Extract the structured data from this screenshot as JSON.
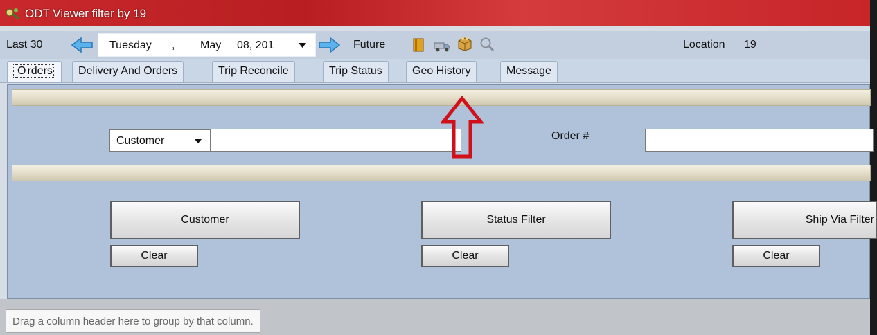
{
  "window": {
    "title": "ODT Viewer filter by 19",
    "app_icon": "filter-app-icon"
  },
  "toolbar": {
    "last_label": "Last 30",
    "date": {
      "day": "Tuesday",
      "sep": ",",
      "month": "May",
      "date": "08, 201"
    },
    "future_label": "Future",
    "location_label": "Location",
    "location_value": "19",
    "icons": [
      "back-arrow-icon",
      "forward-arrow-icon",
      "book-icon",
      "truck-icon",
      "package-icon",
      "search-icon"
    ]
  },
  "tabs": [
    {
      "pre": "",
      "u": "O",
      "post": "rders",
      "active": true
    },
    {
      "pre": "",
      "u": "D",
      "post": "elivery And Orders",
      "active": false
    },
    {
      "pre": "Trip ",
      "u": "R",
      "post": "econcile",
      "active": false
    },
    {
      "pre": "Trip ",
      "u": "S",
      "post": "tatus",
      "active": false
    },
    {
      "pre": "Geo ",
      "u": "H",
      "post": "istory",
      "active": false
    },
    {
      "pre": "Message",
      "u": "",
      "post": "",
      "active": false
    }
  ],
  "filters": {
    "search_by": "Customer",
    "search_value": "",
    "order_label": "Order #",
    "order_value": ""
  },
  "buttons": {
    "customer": "Customer",
    "status_filter": "Status Filter",
    "ship_via_filter": "Ship Via Filter",
    "clear": "Clear"
  },
  "grid": {
    "group_hint": "Drag a column header here to group by that column."
  },
  "colors": {
    "title_bar": "#c9292c",
    "panel": "#b0c2d9",
    "callout_arrow": "#d0101a"
  }
}
